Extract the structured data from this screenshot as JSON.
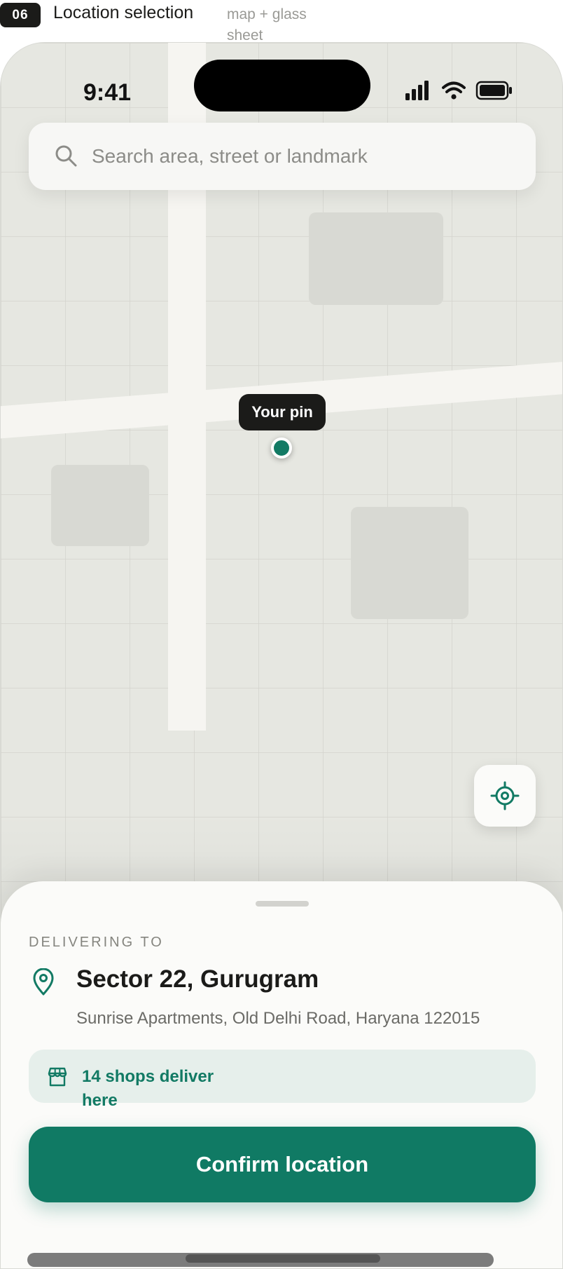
{
  "header": {
    "number": "06",
    "title": "Location selection",
    "subtitle": "map + glass sheet"
  },
  "status_bar": {
    "time": "9:41",
    "icons": [
      "signal-icon",
      "wifi-icon",
      "battery-icon"
    ]
  },
  "search": {
    "placeholder": "Search area, street or landmark",
    "icon": "search-icon"
  },
  "map": {
    "pin_label": "Your pin",
    "locate_icon": "crosshair-icon"
  },
  "sheet": {
    "eyebrow": "DELIVERING TO",
    "location_title": "Sector 22, Gurugram",
    "location_subtitle": "Sunrise Apartments, Old Delhi Road, Haryana 122015",
    "shops_text": "14 shops deliver here",
    "confirm_label": "Confirm location"
  },
  "colors": {
    "accent": "#107a64",
    "chip_bg": "#e6efeb",
    "map_bg": "#e6e7e1",
    "road": "#f6f5f1"
  }
}
